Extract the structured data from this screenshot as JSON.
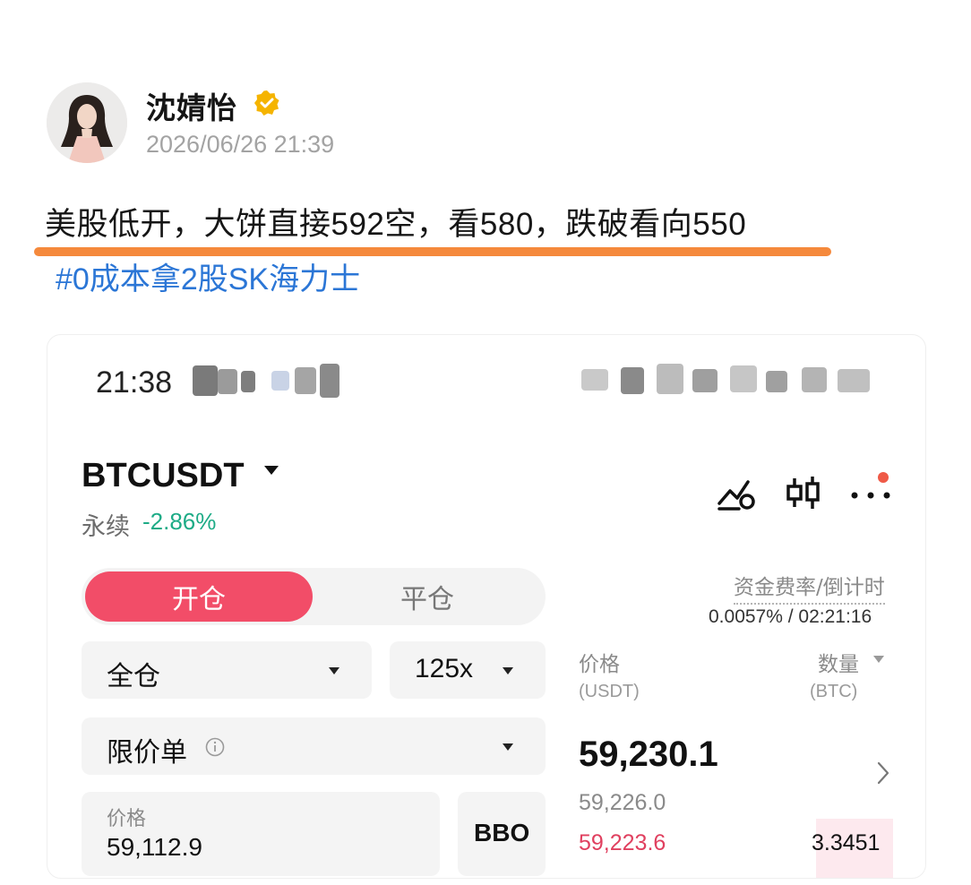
{
  "post": {
    "author": "沈婧怡",
    "timestamp": "2026/06/26 21:39",
    "text": "美股低开，大饼直接592空，看580，跌破看向550",
    "hashtag": "#0成本拿2股SK海力士"
  },
  "colors": {
    "verified_badge": "#f5b400",
    "underline": "#f5893c",
    "hashtag": "#2b76d6",
    "open_button": "#f24d68",
    "positive_green": "#1dab86",
    "ask_red": "#e0405f"
  },
  "screenshot": {
    "status_time": "21:38",
    "symbol": "BTCUSDT",
    "contract_type": "永续",
    "change_pct": "-2.86%",
    "tabs": {
      "open": "开仓",
      "close": "平仓"
    },
    "funding": {
      "title": "资金费率/倒计时",
      "value": "0.0057% / 02:21:16"
    },
    "margin_mode": "全仓",
    "leverage": "125x",
    "order_type": "限价单",
    "price_field": {
      "label": "价格",
      "value": "59,112.9"
    },
    "bbo_label": "BBO",
    "orderbook": {
      "price_header": "价格",
      "price_unit": "(USDT)",
      "qty_header": "数量",
      "qty_unit": "(BTC)",
      "last_price": "59,230.1",
      "rows": [
        {
          "price": "59,226.0",
          "qty": ""
        },
        {
          "price": "59,223.6",
          "qty": "3.3451"
        }
      ]
    },
    "icons": [
      "chart-signal-icon",
      "candlestick-icon",
      "more-icon",
      "chevron-right-icon",
      "info-icon"
    ]
  }
}
